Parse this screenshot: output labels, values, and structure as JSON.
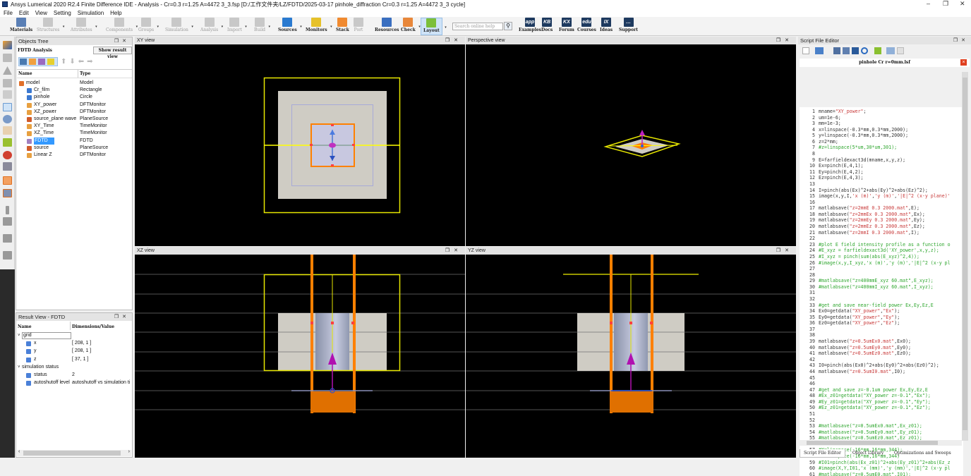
{
  "window": {
    "title": "Ansys Lumerical 2020 R2.4 Finite Difference IDE - Analysis - Cr=0.3  r=1.25 A=4472 3_3.fsp [D:/工作文件夹/LZ/FDTD/2025-03-17 pinhole_diffraction Cr=0.3  r=1.25 A=4472 3_3 cycle]",
    "controls": {
      "minimize": "–",
      "maximize": "❐",
      "close": "✕"
    }
  },
  "menu": [
    "File",
    "Edit",
    "View",
    "Setting",
    "Simulation",
    "Help"
  ],
  "toolbar": {
    "items": [
      {
        "label": "Materials",
        "icon": "materials-icon",
        "color": "#5a7fb5",
        "enabled": true,
        "dropdown": false
      },
      {
        "label": "Structures",
        "icon": "structures-icon",
        "enabled": false,
        "dropdown": true
      },
      {
        "label": "Attributes",
        "icon": "attributes-icon",
        "enabled": false,
        "dropdown": true
      },
      {
        "label": "Components",
        "icon": "components-icon",
        "enabled": false,
        "dropdown": true
      },
      {
        "label": "Groups",
        "icon": "groups-icon",
        "enabled": false,
        "dropdown": true
      },
      {
        "label": "Simulation",
        "icon": "simulation-icon",
        "enabled": false,
        "dropdown": true
      },
      {
        "label": "Analysis",
        "icon": "analysis-icon",
        "enabled": false,
        "dropdown": true
      },
      {
        "label": "Import",
        "icon": "import-icon",
        "enabled": false,
        "dropdown": true
      },
      {
        "label": "Build",
        "icon": "build-icon",
        "enabled": false,
        "dropdown": true
      },
      {
        "label": "Sources",
        "icon": "sources-icon",
        "color": "#2a7ad0",
        "enabled": true,
        "dropdown": true
      },
      {
        "label": "Monitors",
        "icon": "monitors-icon",
        "color": "#e6c12a",
        "enabled": true,
        "dropdown": true
      },
      {
        "label": "Stack",
        "icon": "stack-icon",
        "color": "#f08a30",
        "enabled": true,
        "dropdown": false
      },
      {
        "label": "Port",
        "icon": "port-icon",
        "enabled": false,
        "dropdown": false
      },
      {
        "label": "Resources",
        "icon": "resources-icon",
        "color": "#3a6fc0",
        "enabled": true,
        "dropdown": false
      },
      {
        "label": "Check",
        "icon": "check-icon",
        "color": "#e8873a",
        "enabled": true,
        "dropdown": true
      },
      {
        "label": "Layout",
        "icon": "layout-icon",
        "color": "#7cbf3a",
        "enabled": true,
        "dropdown": true,
        "active": true
      },
      {
        "label": "Examples",
        "icon": "examples-icon",
        "badge": "app",
        "enabled": true
      },
      {
        "label": "Docs",
        "icon": "docs-icon",
        "badge": "KB",
        "enabled": true
      },
      {
        "label": "Forum",
        "icon": "forum-icon",
        "badge": "KX",
        "enabled": true
      },
      {
        "label": "Courses",
        "icon": "courses-icon",
        "badge": "edu",
        "enabled": true
      },
      {
        "label": "Ideas",
        "icon": "ideas-icon",
        "badge": "IX",
        "enabled": true
      },
      {
        "label": "Support",
        "icon": "support-icon",
        "badge": "…",
        "enabled": true
      }
    ],
    "search_placeholder": "Search online help"
  },
  "objects_tree": {
    "title": "Objects Tree",
    "subtitle": "FDTD Analysis",
    "show_result_button": "Show result view",
    "columns": [
      "Name",
      "Type"
    ],
    "rows": [
      {
        "name": "model",
        "type": "Model",
        "indent": 0,
        "color": "#e0702a"
      },
      {
        "name": "Cr_film",
        "type": "Rectangle",
        "indent": 1,
        "color": "#3a78d0"
      },
      {
        "name": "pinhole",
        "type": "Circle",
        "indent": 1,
        "color": "#3a78d0"
      },
      {
        "name": "XY_power",
        "type": "DFTMonitor",
        "indent": 1,
        "color": "#e8a040"
      },
      {
        "name": "XZ_power",
        "type": "DFTMonitor",
        "indent": 1,
        "color": "#e8a040"
      },
      {
        "name": "source_plane wave",
        "type": "PlaneSource",
        "indent": 1,
        "color": "#d05a2a"
      },
      {
        "name": "XY_Time",
        "type": "TimeMonitor",
        "indent": 1,
        "color": "#e8a040"
      },
      {
        "name": "XZ_Time",
        "type": "TimeMonitor",
        "indent": 1,
        "color": "#e8a040"
      },
      {
        "name": "FDTD",
        "type": "FDTD",
        "indent": 1,
        "color": "#a080c0",
        "selected": true
      },
      {
        "name": "source",
        "type": "PlaneSource",
        "indent": 1,
        "color": "#d05a2a"
      },
      {
        "name": "Linear Z",
        "type": "DFTMonitor",
        "indent": 1,
        "color": "#e8a040"
      }
    ]
  },
  "result_view": {
    "title": "Result View - FDTD",
    "columns": [
      "Name",
      "Dimensions/Value"
    ],
    "rows": [
      {
        "name": "grid",
        "value": "",
        "level": 0,
        "group": true
      },
      {
        "name": "x",
        "value": "[ 208, 1 ]",
        "level": 1
      },
      {
        "name": "y",
        "value": "[ 208, 1 ]",
        "level": 1
      },
      {
        "name": "z",
        "value": "[ 37, 1 ]",
        "level": 1
      },
      {
        "name": "simulation status",
        "value": "",
        "level": 0,
        "group": true
      },
      {
        "name": "status",
        "value": "2",
        "level": 1
      },
      {
        "name": "autoshutoff level",
        "value": "autoshutoff vs simulation ti",
        "level": 1
      }
    ]
  },
  "views": {
    "xy": "XY view",
    "perspective": "Perspective view",
    "xz": "XZ view",
    "yz": "YZ view"
  },
  "script_editor": {
    "title": "Script File Editor",
    "file_tab": "pinhole Cr r=0mm.lsf",
    "lines": [
      "mname=\"XY_power\";",
      "um=1e-6;",
      "mm=1e-3;",
      "x=linspace(-0.3*mm,0.3*mm,2000);",
      "y=linspace(-0.3*mm,0.3*mm,2000);",
      "z=2*mm;",
      "#z=linspace(5*um,30*um,301);",
      "",
      "E=farfieldexact3d(mname,x,y,z);",
      "Ex=pinch(E,4,1);",
      "Ey=pinch(E,4,2);",
      "Ez=pinch(E,4,3);",
      "",
      "I=pinch(abs(Ex)^2+abs(Ey)^2+abs(Ez)^2);",
      "image(x,y,I,'x (m)','y (m)','|E|^2 (x-y plane)'",
      "",
      "matlabsave(\"z=2mmE 0.3 2000.mat\",E);",
      "matlabsave(\"z=2mmEx 0.3 2000.mat\",Ex);",
      "matlabsave(\"z=2mmEy 0.3 2000.mat\",Ey);",
      "matlabsave(\"z=2mmEz 0.3 2000.mat\",Ez);",
      "matlabsave(\"z=2mmI 0.3 2000.mat\",I);",
      "",
      "#plot E field intensity profile as a function o",
      "#E_xyz = farfieldexact3d('XY_power',x,y,z);",
      "#I_xyz = pinch(sum(abs(E_xyz)^2,4));",
      "#image(x,y,I_xyz,'x (m)','y (m)','|E|^2 (x-y pl",
      "",
      "",
      "#matlabsave(\"z=400mmE_xyz 60.mat\",E_xyz);",
      "#matlabsave(\"z=400mmI_xyz 60.mat\",I_xyz);",
      "",
      "",
      "#get and save near-field power Ex,Ey,Ez,E",
      "Ex0=getdata(\"XY_power\",\"Ex\");",
      "Ey0=getdata(\"XY_power\",\"Ey\");",
      "Ez0=getdata(\"XY_power\",\"Ez\");",
      "",
      "",
      "matlabsave(\"z=0.5umEx0.mat\",Ex0);",
      "matlabsave(\"z=0.5umEy0.mat\",Ey0);",
      "matlabsave(\"z=0.5umEz0.mat\",Ez0);",
      "",
      "I0=pinch(abs(Ex0)^2+abs(Ey0)^2+abs(Ez0)^2);",
      "matlabsave(\"z=0.5umI0.mat\",I0);",
      "",
      "",
      "#get and save z=-0.1um power Ex,Ey,Ez,E",
      "#Ex_z01=getdata(\"XY_power z=-0.1\",\"Ex\");",
      "#Ey_z01=getdata(\"XY_power z=-0.1\",\"Ey\");",
      "#Ez_z01=getdata(\"XY_power z=-0.1\",\"Ez\");",
      "",
      "",
      "#matlabsave(\"z=0.5umEx0.mat\",Ex_z01);",
      "#matlabsave(\"z=0.5umEy0.mat\",Ey_z01);",
      "#matlabsave(\"z=0.5umEz0.mat\",Ez_z01);",
      "",
      "#X=linspace(-16*mm,16*mm,344);",
      "#Y=linspace(-16*mm,16*mm,344)",
      "#I01=pinch(abs(Ex_z01)^2+abs(Ey_z01)^2+abs(Ez_z",
      "#image(X,Y,I01,'x (mm)','y (mm)','|E|^2 (x-y pl",
      "#matlabsave(\"z=0.5umE0.mat\",I01);"
    ],
    "bottom_tabs": [
      "Script File Editor",
      "Object Library",
      "Optimizations and Sweeps"
    ]
  },
  "colors": {
    "string": "#c83a3a",
    "comment": "#2ea62e",
    "selection": "#3399ff",
    "monitor_orange": "#ff8000",
    "fdtd_yellow": "#e6e600"
  }
}
